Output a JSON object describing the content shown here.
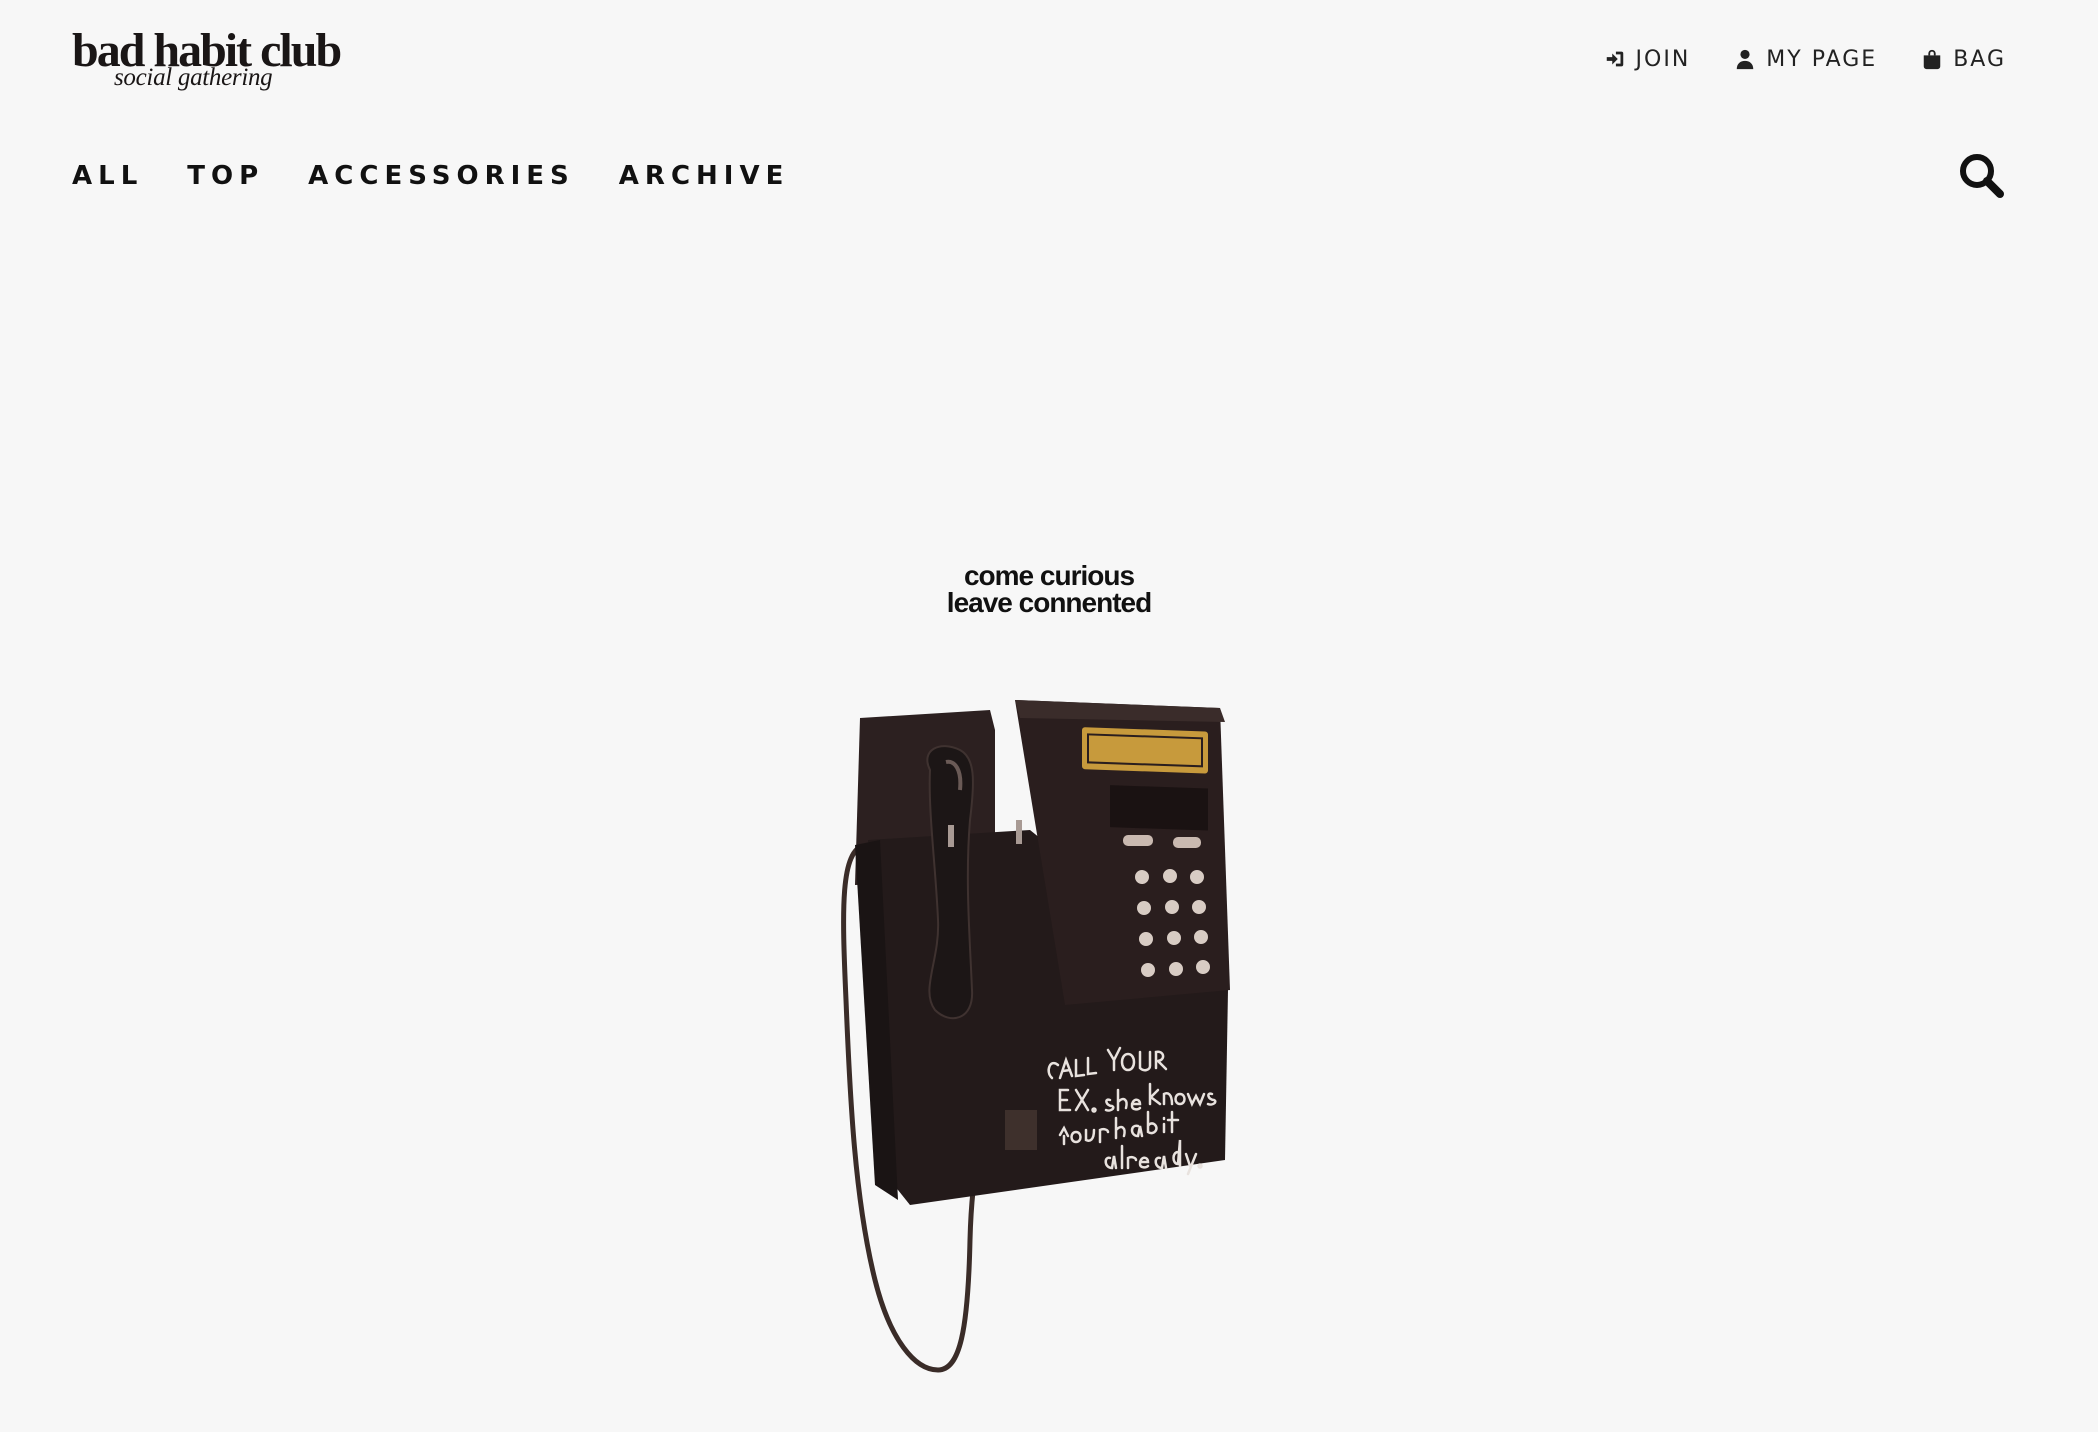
{
  "brand": {
    "name": "bad habit club",
    "tagline": "social gathering"
  },
  "util_nav": [
    {
      "label": "JOIN",
      "icon": "sign-in-icon"
    },
    {
      "label": "MY PAGE",
      "icon": "user-icon"
    },
    {
      "label": "BAG",
      "icon": "shopping-bag-icon"
    }
  ],
  "main_nav": [
    {
      "label": "ALL"
    },
    {
      "label": "TOP"
    },
    {
      "label": "ACCESSORIES"
    },
    {
      "label": "ARCHIVE"
    }
  ],
  "search": {
    "icon": "search-icon"
  },
  "hero": {
    "line1": "come curious",
    "line2": "leave connented",
    "image": "payphone-image",
    "handwriting": "CALL YOUR EX. she knows your habit already."
  },
  "colors": {
    "background": "#f7f7f7",
    "text": "#1c1c1c",
    "phone_body": "#2a1e1e",
    "label_plate": "#c79a3c"
  }
}
